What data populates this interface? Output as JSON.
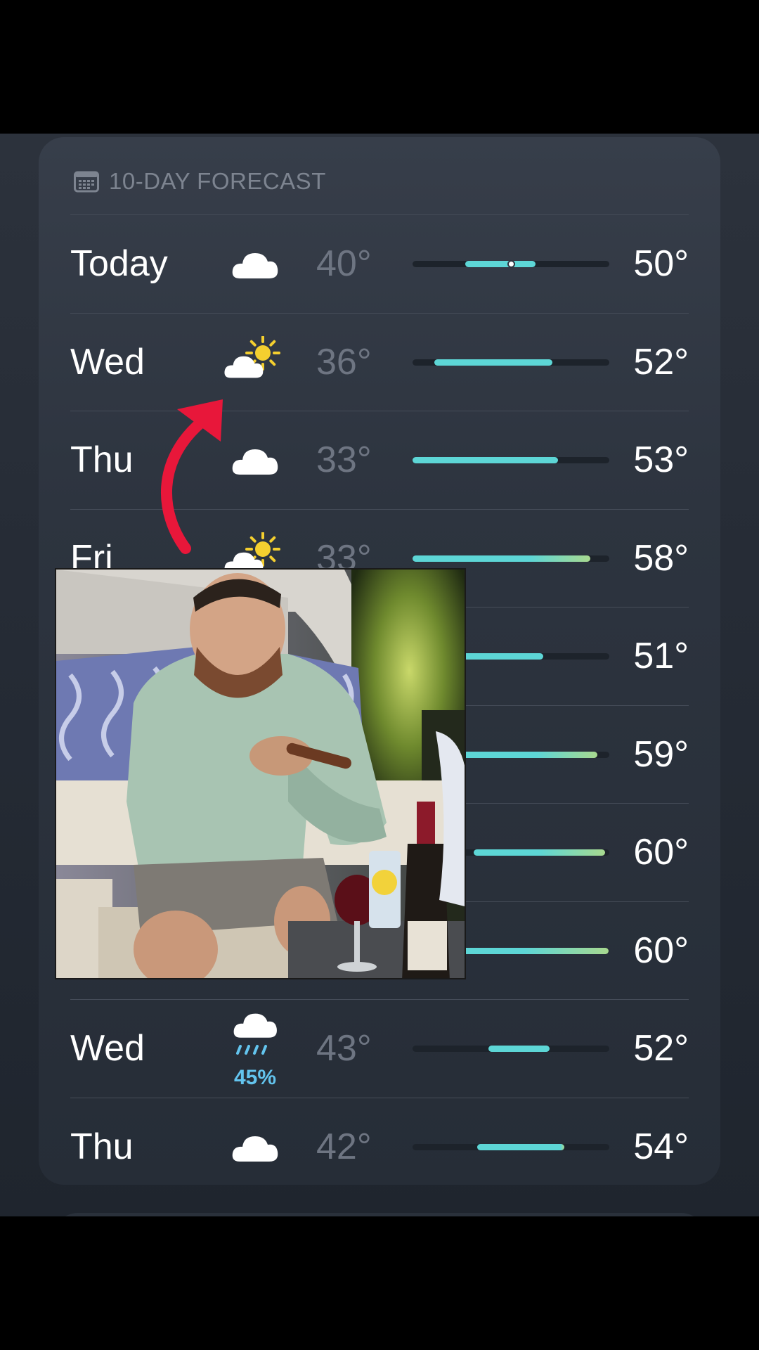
{
  "card": {
    "header_icon": "calendar-icon",
    "title": "10-DAY FORECAST"
  },
  "colors": {
    "cool": "#5dd6d6",
    "warm": "#a8d98f",
    "precip": "#63c4ee",
    "arrow": "#e8173a"
  },
  "forecast": [
    {
      "day": "Today",
      "icon": "cloud-icon",
      "low": "40°",
      "high": "50°",
      "bar_start": 0.268,
      "bar_end": 0.624,
      "current_pos": 0.5
    },
    {
      "day": "Wed",
      "icon": "partly-sunny-icon",
      "low": "36°",
      "high": "52°",
      "bar_start": 0.11,
      "bar_end": 0.71
    },
    {
      "day": "Thu",
      "icon": "cloud-icon",
      "low": "33°",
      "high": "53°",
      "bar_start": 0.0,
      "bar_end": 0.74
    },
    {
      "day": "Fri",
      "icon": "partly-sunny-icon",
      "low": "33°",
      "high": "58°",
      "bar_start": 0.0,
      "bar_end": 0.905
    },
    {
      "day": "",
      "icon": "",
      "low": "",
      "high": "51°",
      "bar_start": 0.12,
      "bar_end": 0.665
    },
    {
      "day": "",
      "icon": "",
      "low": "",
      "high": "59°",
      "bar_start": 0.2,
      "bar_end": 0.94
    },
    {
      "day": "",
      "icon": "",
      "low": "",
      "high": "60°",
      "bar_start": 0.31,
      "bar_end": 0.98
    },
    {
      "day": "",
      "icon": "",
      "low": "",
      "high": "60°",
      "bar_start": 0.2,
      "bar_end": 0.995
    },
    {
      "day": "Wed",
      "icon": "rain-icon",
      "precip": "45%",
      "low": "43°",
      "high": "52°",
      "bar_start": 0.385,
      "bar_end": 0.695
    },
    {
      "day": "Thu",
      "icon": "cloud-icon",
      "low": "42°",
      "high": "54°",
      "bar_start": 0.33,
      "bar_end": 0.77
    }
  ],
  "overlay": {
    "arrow_icon": "red-curved-arrow-icon",
    "photo": "photo-man-with-cigar"
  }
}
